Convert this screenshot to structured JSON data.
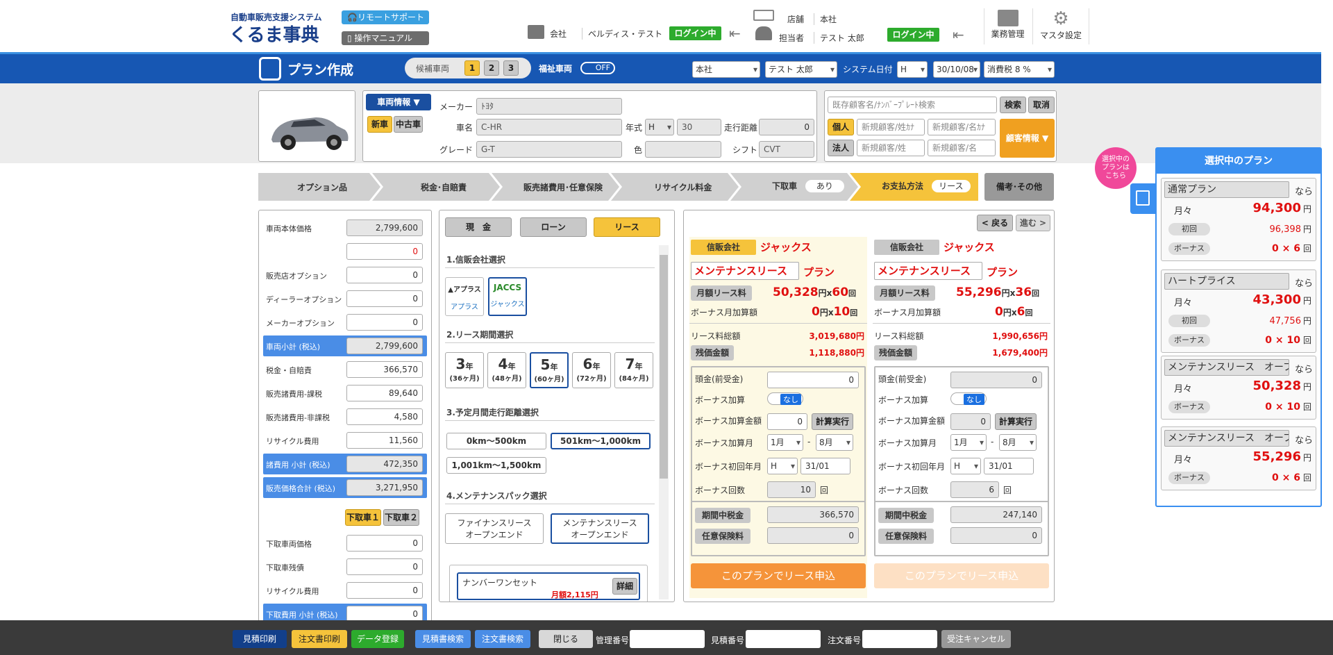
{
  "header": {
    "logo_sub": "自動車販売支援システム",
    "logo_main": "くるま事典",
    "remote_support": "リモートサポート",
    "manual": "操作マニュアル",
    "company_label": "会社",
    "company_value": "ベルディス・テスト",
    "login_status1": "ログイン中",
    "store_label": "店舗",
    "store_value": "本社",
    "person_label": "担当者",
    "person_value": "テスト 太郎",
    "login_status2": "ログイン中",
    "business": "業務管理",
    "master": "マスタ設定"
  },
  "bar": {
    "title": "プラン作成",
    "candidate": "候補車両",
    "cand_nums": [
      "1",
      "2",
      "3"
    ],
    "welfare": "福祉車両",
    "toggle": "OFF",
    "store": "本社",
    "person": "テスト 太郎",
    "sysdate_label": "システム日付",
    "era": "H",
    "date": "30/10/08",
    "tax": "消費税 8 %"
  },
  "vehicle": {
    "info_btn": "車両情報 ▼",
    "new": "新車",
    "used": "中古車",
    "maker_label": "メーカー",
    "maker": "ﾄﾖﾀ",
    "name_label": "車名",
    "name": "C-HR",
    "year_label": "年式",
    "year_era": "H",
    "year": "30",
    "mileage_label": "走行距離",
    "mileage": "0",
    "grade_label": "グレード",
    "grade": "G-T",
    "color_label": "色",
    "color": "",
    "shift_label": "シフト",
    "shift": "CVT"
  },
  "customer": {
    "search_placeholder": "既存顧客名/ﾅﾝﾊﾞｰﾌﾟﾚｰﾄ検索",
    "search": "検索",
    "cancel": "取消",
    "individual": "個人",
    "corporate": "法人",
    "ph1": "新規顧客/姓ｶﾅ",
    "ph2": "新規顧客/名ｶﾅ",
    "ph3": "新規顧客/姓",
    "ph4": "新規顧客/名",
    "info_btn": "顧客情報 ▼"
  },
  "steps": [
    {
      "label": "オプション品"
    },
    {
      "label": "税金･自賠責"
    },
    {
      "label": "販売諸費用･任意保険"
    },
    {
      "label": "リサイクル料金"
    },
    {
      "label": "下取車",
      "badge": "あり"
    },
    {
      "label": "お支払方法",
      "badge": "リース"
    }
  ],
  "memo": "備考･その他",
  "left": {
    "rows": [
      {
        "label": "車両本体価格",
        "value": "2,799,600",
        "ro": true
      },
      {
        "label": "",
        "value": "0",
        "red": true
      },
      {
        "label": "販売店オプション",
        "value": "0"
      },
      {
        "label": "ディーラーオプション",
        "value": "0"
      },
      {
        "label": "メーカーオプション",
        "value": "0"
      },
      {
        "label": "車両小計 (税込)",
        "value": "2,799,600",
        "ro": true,
        "blue": true
      },
      {
        "label": "税金・自賠責",
        "value": "366,570"
      },
      {
        "label": "販売諸費用-課税",
        "value": "89,640"
      },
      {
        "label": "販売諸費用-非課税",
        "value": "4,580"
      },
      {
        "label": "リサイクル費用",
        "value": "11,560"
      },
      {
        "label": "諸費用 小計 (税込)",
        "value": "472,350",
        "ro": true,
        "blue": true
      },
      {
        "label": "販売価格合計 (税込)",
        "value": "3,271,950",
        "ro": true,
        "blue": true
      }
    ],
    "trade1": "下取車１",
    "trade2": "下取車２",
    "trade_rows": [
      {
        "label": "下取車両価格",
        "value": "0"
      },
      {
        "label": "下取車残債",
        "value": "0"
      },
      {
        "label": "リサイクル費用",
        "value": "0"
      },
      {
        "label": "下取費用 小計 (税込)",
        "value": "0",
        "blue": true
      }
    ]
  },
  "pay": {
    "tabs": [
      "現　金",
      "ローン",
      "リース"
    ],
    "s1": "1.信販会社選択",
    "c1": "アプラス",
    "c2": "ジャックス",
    "s2": "2.リース期間選択",
    "periods": [
      {
        "y": "3",
        "m": "(36ヶ月)"
      },
      {
        "y": "4",
        "m": "(48ヶ月)"
      },
      {
        "y": "5",
        "m": "(60ヶ月)"
      },
      {
        "y": "6",
        "m": "(72ヶ月)"
      },
      {
        "y": "7",
        "m": "(84ヶ月)"
      }
    ],
    "year_unit": "年",
    "s3": "3.予定月間走行距離選択",
    "d1": "0km～500km",
    "d2": "501km～1,000km",
    "d3": "1,001km～1,500km",
    "s4": "4.メンテナンスパック選択",
    "m1a": "ファイナンスリース",
    "m1b": "オープンエンド",
    "m2a": "メンテナンスリース",
    "m2b": "オープンエンド",
    "pack": "ナンバーワンセット",
    "pack_price": "月額2,115円",
    "detail": "詳細"
  },
  "plans": {
    "back": "< 戻る",
    "next": "進む >",
    "p1": {
      "co_label": "信販会社",
      "co": "ジャックス",
      "type": "メンテナンスリース",
      "plan": "プラン",
      "monthly_label": "月額リース料",
      "monthly": "50,328",
      "unit1": "円x",
      "count": "60",
      "unit2": "回",
      "bonus_label": "ボーナス月加算額",
      "bonus": "0",
      "bcount": "10",
      "total_label": "リース料総額",
      "total": "3,019,680円",
      "residual_label": "残価金額",
      "residual": "1,118,880円",
      "down_label": "頭金(前受金)",
      "down": "0",
      "badd_label": "ボーナス加算",
      "badd": "なし",
      "bamt_label": "ボーナス加算金額",
      "bamt": "0",
      "calc": "計算実行",
      "bmonth_label": "ボーナス加算月",
      "m1": "1月",
      "m2": "8月",
      "bfirst_label": "ボーナス初回年月",
      "era": "H",
      "first": "31/01",
      "bnum_label": "ボーナス回数",
      "bnum": "10",
      "kai": "回",
      "tax_label": "期間中税金",
      "tax": "366,570",
      "ins_label": "任意保険料",
      "ins": "0",
      "apply": "このプランでリース申込"
    },
    "p2": {
      "co_label": "信販会社",
      "co": "ジャックス",
      "type": "メンテナンスリース",
      "plan": "プラン",
      "monthly_label": "月額リース料",
      "monthly": "55,296",
      "unit1": "円x",
      "count": "36",
      "unit2": "回",
      "bonus_label": "ボーナス月加算額",
      "bonus": "0",
      "bcount": "6",
      "total_label": "リース料総額",
      "total": "1,990,656円",
      "residual_label": "残価金額",
      "residual": "1,679,400円",
      "down_label": "頭金(前受金)",
      "down": "0",
      "badd_label": "ボーナス加算",
      "badd": "なし",
      "bamt_label": "ボーナス加算金額",
      "bamt": "0",
      "calc": "計算実行",
      "bmonth_label": "ボーナス加算月",
      "m1": "1月",
      "m2": "8月",
      "bfirst_label": "ボーナス初回年月",
      "era": "H",
      "first": "31/01",
      "bnum_label": "ボーナス回数",
      "bnum": "6",
      "kai": "回",
      "tax_label": "期間中税金",
      "tax": "247,140",
      "ins_label": "任意保険料",
      "ins": "0",
      "apply": "このプランでリース申込"
    }
  },
  "selected": {
    "bubble": "選択中の\nプランは\nこちら",
    "title": "選択中のプラン",
    "cards": [
      {
        "name": "通常プラン",
        "nara": "なら",
        "monthly_label": "月々",
        "monthly": "94,300",
        "yen": "円",
        "first_label": "初回",
        "first": "96,398",
        "bonus_label": "ボーナス",
        "bonus": "0 × 6",
        "kai": "回"
      },
      {
        "name": "ハートプライス",
        "nara": "なら",
        "monthly_label": "月々",
        "monthly": "43,300",
        "yen": "円",
        "first_label": "初回",
        "first": "47,756",
        "bonus_label": "ボーナス",
        "bonus": "0 × 10",
        "kai": "回"
      },
      {
        "name": "メンテナンスリース　オープ",
        "nara": "なら",
        "monthly_label": "月々",
        "monthly": "50,328",
        "yen": "円",
        "bonus_label": "ボーナス",
        "bonus": "0 × 10",
        "kai": "回"
      },
      {
        "name": "メンテナンスリース　オープ",
        "nara": "なら",
        "monthly_label": "月々",
        "monthly": "55,296",
        "yen": "円",
        "bonus_label": "ボーナス",
        "bonus": "0 × 6",
        "kai": "回"
      }
    ]
  },
  "footer": {
    "b1": "見積印刷",
    "b2": "注文書印刷",
    "b3": "データ登録",
    "b4": "見積書検索",
    "b5": "注文書検索",
    "b6": "閉じる",
    "mgmt": "管理番号",
    "est": "見積番号",
    "order": "注文番号",
    "cancel": "受注キャンセル"
  }
}
